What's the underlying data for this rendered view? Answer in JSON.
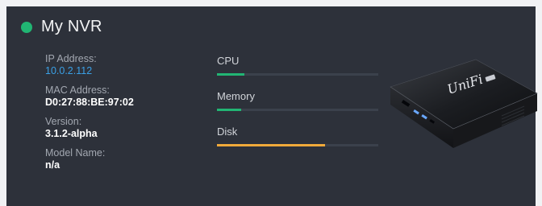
{
  "colors": {
    "status_online": "#21b573",
    "link": "#3aa0e6",
    "bar_ok": "#22b574",
    "bar_warning": "#f0a93a"
  },
  "header": {
    "status_icon": "status-online-icon",
    "title": "My NVR"
  },
  "info": [
    {
      "label": "IP Address:",
      "value": "10.0.2.112",
      "link": true
    },
    {
      "label": "MAC Address:",
      "value": "D0:27:88:BE:97:02",
      "link": false
    },
    {
      "label": "Version:",
      "value": "3.1.2-alpha",
      "link": false
    },
    {
      "label": "Model Name:",
      "value": "n/a",
      "link": false
    }
  ],
  "metrics": [
    {
      "label": "CPU",
      "level": 0.17,
      "status": "ok"
    },
    {
      "label": "Memory",
      "level": 0.15,
      "status": "ok"
    },
    {
      "label": "Disk",
      "level": 0.67,
      "status": "warning"
    }
  ],
  "device": {
    "image": "unifi-nvr-device-image",
    "logo_text": "UniFi"
  }
}
